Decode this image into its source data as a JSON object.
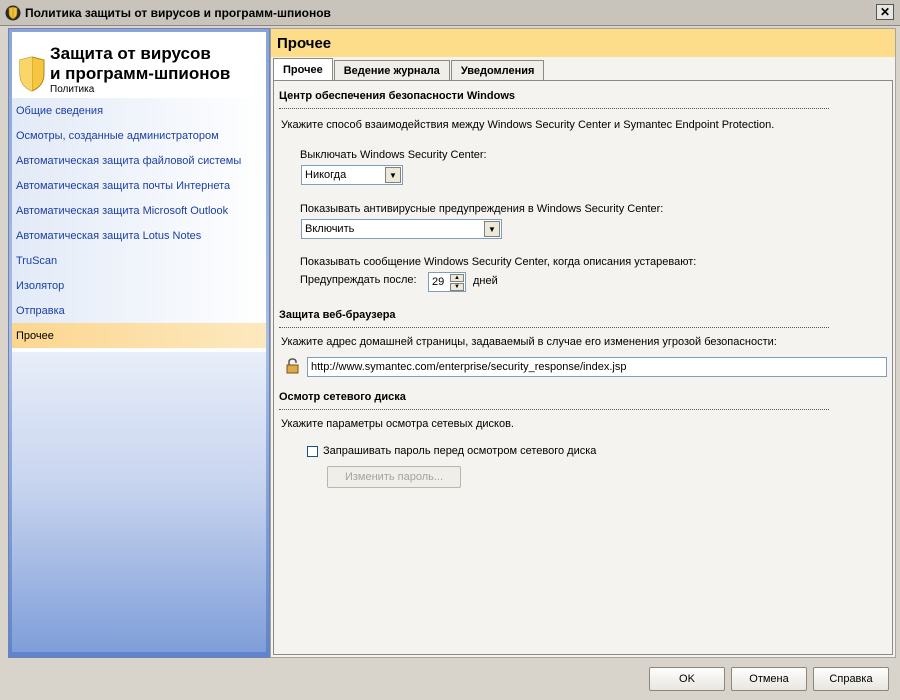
{
  "window": {
    "title": "Политика защиты от вирусов и программ-шпионов",
    "close_glyph": "✕"
  },
  "sidebar": {
    "heading_line1": "Защита от вирусов",
    "heading_line2": "и программ-шпионов",
    "subheading": "Политика",
    "items": [
      {
        "label": "Общие сведения"
      },
      {
        "label": "Осмотры, созданные администратором"
      },
      {
        "label": "Автоматическая защита файловой системы"
      },
      {
        "label": "Автоматическая защита почты Интернета"
      },
      {
        "label": "Автоматическая защита Microsoft Outlook"
      },
      {
        "label": "Автоматическая защита Lotus Notes"
      },
      {
        "label": "TruScan"
      },
      {
        "label": "Изолятор"
      },
      {
        "label": "Отправка"
      },
      {
        "label": "Прочее",
        "active": true
      }
    ]
  },
  "main": {
    "title": "Прочее",
    "tabs": [
      {
        "label": "Прочее",
        "active": true
      },
      {
        "label": "Ведение журнала"
      },
      {
        "label": "Уведомления"
      }
    ],
    "wsc": {
      "title": "Центр обеспечения безопасности Windows",
      "description": "Укажите способ взаимодействия между Windows Security Center и Symantec Endpoint Protection.",
      "disable_label": "Выключать Windows Security Center:",
      "disable_value": "Никогда",
      "alerts_label": "Показывать антивирусные предупреждения в Windows Security Center:",
      "alerts_value": "Включить",
      "outdated_label": "Показывать сообщение Windows Security Center, когда описания устаревают:",
      "warn_after_label": "Предупреждать после:",
      "warn_after_value": "29",
      "days_label": "дней"
    },
    "browser": {
      "title": "Защита веб-браузера",
      "description": "Укажите адрес домашней страницы, задаваемый в случае его изменения угрозой безопасности:",
      "homepage_value": "http://www.symantec.com/enterprise/security_response/index.jsp"
    },
    "netdrive": {
      "title": "Осмотр сетевого диска",
      "description": "Укажите параметры осмотра сетевых дисков.",
      "ask_password_label": "Запрашивать пароль перед осмотром сетевого диска",
      "ask_password_checked": false,
      "change_password_label": "Изменить пароль..."
    }
  },
  "footer": {
    "ok_label": "OK",
    "cancel_label": "Отмена",
    "help_label": "Справка"
  },
  "icons": {
    "app": "shield-icon",
    "lock": "padlock-icon",
    "dropdown": "chevron-down-icon"
  },
  "colors": {
    "accent_header": "#fddc8a",
    "active_item": "#fbd68f",
    "link": "#1b3fa5"
  }
}
